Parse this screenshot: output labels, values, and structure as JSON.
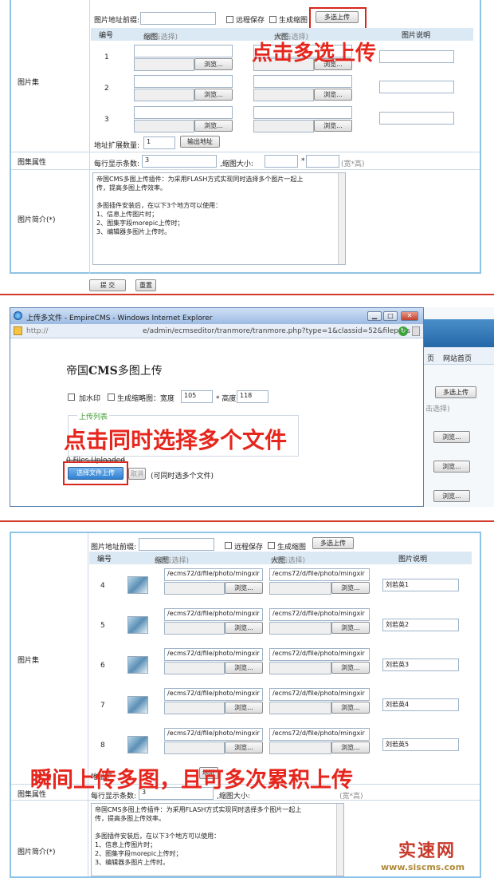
{
  "panel1": {
    "prefix_label": "图片地址前缀:",
    "remote_save": "远程保存",
    "gen_thumb": "生成缩图",
    "multi_upload_btn": "多选上传",
    "col_no": "编号",
    "col_thumb": "缩图",
    "col_thumb_hint": "(双击选择)",
    "col_big": "大图",
    "col_big_hint": "(双击选择)",
    "col_desc": "图片说明",
    "rows": [
      "1",
      "2",
      "3"
    ],
    "browse": "浏览...",
    "ext_count_label": "地址扩展数量:",
    "ext_count_value": "1",
    "output_btn": "输出地址",
    "gallery_label": "图片集",
    "attr_label": "图集属性",
    "per_row_label": "每行显示条数:",
    "per_row_value": "3",
    "thumb_size_label": ",缩图大小:",
    "thumb_size_x": "*",
    "thumb_size_hint": "(宽*高)",
    "intro_label": "图片简介(*)",
    "intro_text": "帝国CMS多图上传插件：为采用FLASH方式实现同时选择多个图片一起上\n传，提高多图上传效率。\n\n多图插件安装后，在以下3个地方可以使用：\n1、信息上传图片时；\n2、图集字段morepic上传时；\n3、编辑器多图片上传时。",
    "submit_btn": "提 交",
    "reset_btn": "重置",
    "annotation": "点击多选上传"
  },
  "panel2": {
    "window_title": "上传多文件 - EmpireCMS - Windows Internet Explorer",
    "address_prefix": "http://",
    "address_url": "e/admin/ecmseditor/tranmore/tranmore.php?type=1&classid=52&filepass",
    "heading_pre": "帝国",
    "heading_bold": "CMS",
    "heading_post": "多图上传",
    "watermark_label": "加水印",
    "thumb_label": "生成缩略图：宽度",
    "width_value": "105",
    "height_label": "* 高度",
    "height_value": "118",
    "list_title": "上传列表",
    "files_uploaded": "0 Files Uploaded",
    "select_btn": "选择文件上传",
    "cancel_btn": "取消",
    "hint": "(可同时选多个文件)",
    "bg_nav_1": "页",
    "bg_nav_2": "网站首页",
    "bg_multi_btn": "多选上传",
    "bg_hint": "击选择)",
    "browse": "浏览...",
    "annotation": "点击同时选择多个文件"
  },
  "panel3": {
    "prefix_label": "图片地址前缀:",
    "remote_save": "远程保存",
    "gen_thumb": "生成缩图",
    "multi_upload_btn": "多选上传",
    "col_no": "编号",
    "col_thumb": "缩图",
    "col_thumb_hint": "(双击选择)",
    "col_big": "大图",
    "col_big_hint": "(双击选择)",
    "col_desc": "图片说明",
    "rows": [
      {
        "no": "4",
        "path": "/ecms72/d/file/photo/mingxir",
        "desc": "刘若英1"
      },
      {
        "no": "5",
        "path": "/ecms72/d/file/photo/mingxir",
        "desc": "刘若英2"
      },
      {
        "no": "6",
        "path": "/ecms72/d/file/photo/mingxir",
        "desc": "刘若英3"
      },
      {
        "no": "7",
        "path": "/ecms72/d/file/photo/mingxir",
        "desc": "刘若英4"
      },
      {
        "no": "8",
        "path": "/ecms72/d/file/photo/mingxir",
        "desc": "刘若英5"
      }
    ],
    "browse": "浏览...",
    "gallery_label": "图片集",
    "ext_label_partial": "地址扩",
    "output_btn_partial": "地址",
    "attr_label": "图集属性",
    "per_row_label": "每行显示条数:",
    "per_row_value": "3",
    "thumb_size_label": ",缩图大小:",
    "thumb_size_hint": "(宽*高)",
    "intro_label": "图片简介(*)",
    "intro_text": "帝国CMS多图上传插件：为采用FLASH方式实现同时选择多个图片一起上\n传，提高多图上传效率。\n\n多图插件安装后，在以下3个地方可以使用：\n1、信息上传图片时；\n2、图集字段morepic上传时；\n3、编辑器多图片上传时。",
    "annotation": "瞬间上传多图，且可多次累积上传"
  },
  "watermark": {
    "cn": "实速网",
    "url": "www.siscms.com"
  }
}
